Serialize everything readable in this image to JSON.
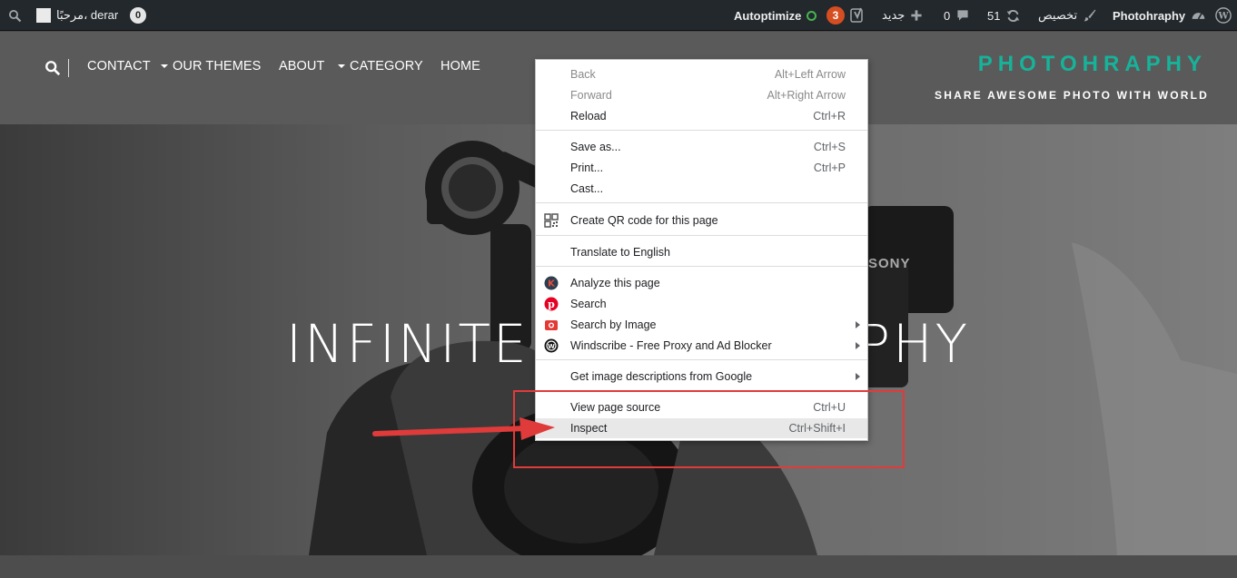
{
  "adminbar": {
    "site_name": "Photohraphy",
    "customize_label": "تخصيص",
    "updates_count": "51",
    "comments_count": "0",
    "new_label": "جديد",
    "yoast_count": "3",
    "autoptimize_label": "Autoptimize",
    "greeting": "مرحبًا، derar",
    "notifications_count": "0"
  },
  "header": {
    "nav": [
      {
        "label": "CONTACT"
      },
      {
        "label": "OUR THEMES"
      },
      {
        "label": "ABOUT"
      },
      {
        "label": "CATEGORY"
      },
      {
        "label": "HOME"
      }
    ],
    "site_title": "PHOTOHRAPHY",
    "tagline": "SHARE AWESOME PHOTO WITH WORLD"
  },
  "hero": {
    "title_left": "INFINITE",
    "title_right": "PHY",
    "camera_brand": "SONY"
  },
  "context_menu": {
    "items": [
      {
        "label": "Back",
        "shortcut": "Alt+Left Arrow"
      },
      {
        "label": "Forward",
        "shortcut": "Alt+Right Arrow"
      },
      {
        "label": "Reload",
        "shortcut": "Ctrl+R"
      },
      {
        "label": "Save as...",
        "shortcut": "Ctrl+S"
      },
      {
        "label": "Print...",
        "shortcut": "Ctrl+P"
      },
      {
        "label": "Cast..."
      },
      {
        "label": "Create QR code for this page"
      },
      {
        "label": "Translate to English"
      },
      {
        "label": "Analyze this page"
      },
      {
        "label": "Search"
      },
      {
        "label": "Search by Image"
      },
      {
        "label": "Windscribe - Free Proxy and Ad Blocker"
      },
      {
        "label": "Get image descriptions from Google"
      },
      {
        "label": "View page source",
        "shortcut": "Ctrl+U"
      },
      {
        "label": "Inspect",
        "shortcut": "Ctrl+Shift+I"
      }
    ]
  },
  "colors": {
    "accent": "#16b39a",
    "annotation": "#e03b3b",
    "adminbar": "#23282d"
  }
}
